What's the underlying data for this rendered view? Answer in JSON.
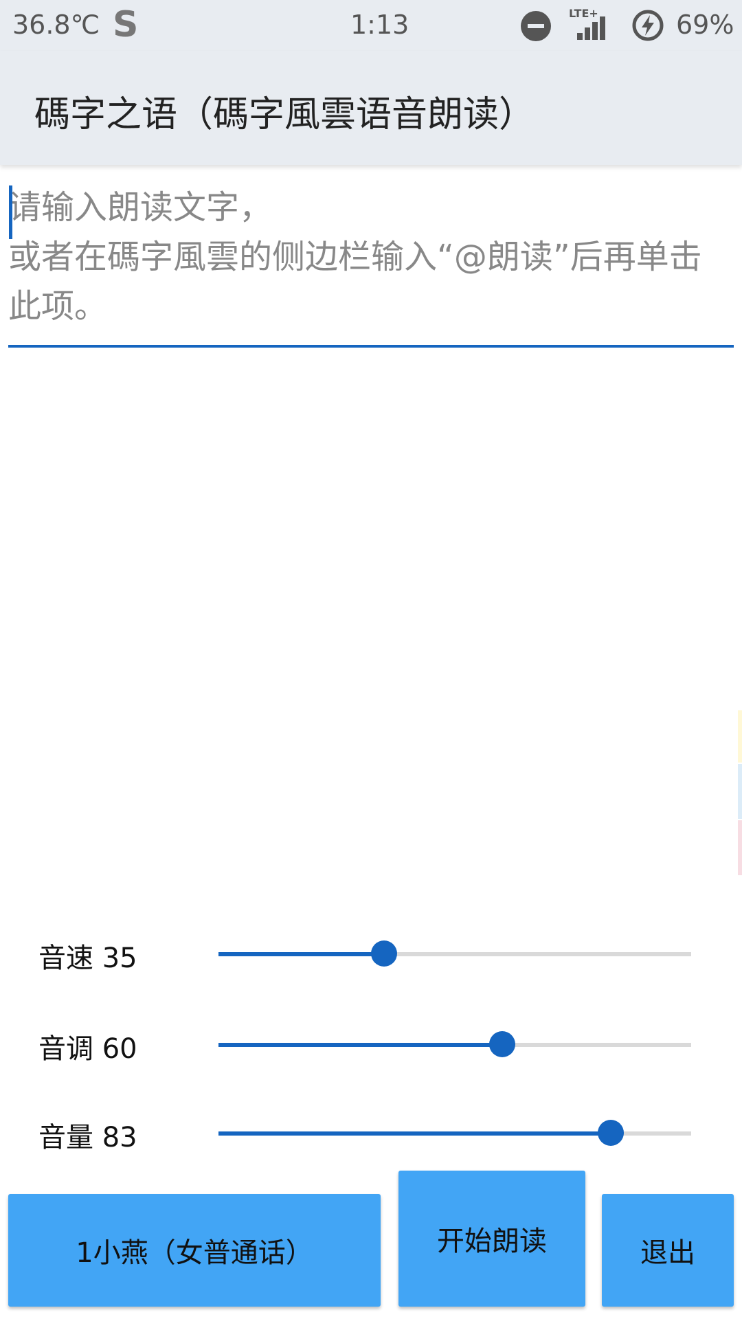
{
  "status": {
    "temperature": "36.8℃",
    "app_logo": "S",
    "time": "1:13",
    "network": "LTE+",
    "battery_percent": "69%",
    "icons": [
      "dnd-icon",
      "signal-icon",
      "battery-charging-icon"
    ]
  },
  "appbar": {
    "title": "碼字之语（碼字風雲语音朗读）"
  },
  "input": {
    "placeholder": "请输入朗读文字，\n或者在碼字風雲的侧边栏输入“@朗读”后再单击此项。"
  },
  "controls": {
    "speed": {
      "label": "音速 35",
      "value": 35
    },
    "pitch": {
      "label": "音调 60",
      "value": 60
    },
    "volume": {
      "label": "音量 83",
      "value": 83
    }
  },
  "buttons": {
    "voice": "1小燕（女普通话）",
    "start": "开始朗读",
    "exit": "退出"
  },
  "colors": {
    "accent": "#1565c0",
    "button": "#42a5f5",
    "bar": "#e8ecf1"
  }
}
